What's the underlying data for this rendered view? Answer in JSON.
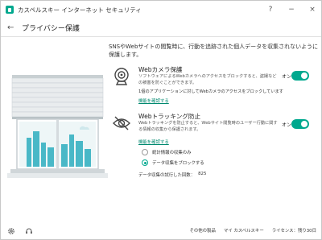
{
  "window": {
    "title": "カスペルスキー インターネット セキュリティ",
    "help": "?",
    "minimize": "−",
    "close": "×"
  },
  "header": {
    "back": "←",
    "title": "プライバシー保護"
  },
  "intro": "SNSやWebサイトの閲覧時に、行動を追跡された個人データを収集されないように保護します。",
  "webcam": {
    "title": "Webカメラ保護",
    "desc": "ソフトウェアによるWebカメラへのアクセスをブロックすると、盗撮などの被害を防ぐことができます。",
    "sub": "1個のアプリケーションに対してWebカメラのアクセスをブロックしています",
    "link": "機能を確認する",
    "toggle_label": "オン",
    "enabled": true
  },
  "tracking": {
    "title": "Webトラッキング防止",
    "desc": "Webトラッキングを防止すると、Webサイト閲覧時のユーザー行動に関する情報の収集から保護されます。",
    "link": "機能を確認する",
    "toggle_label": "オン",
    "enabled": true,
    "options": [
      {
        "label": "統計情報の収集のみ",
        "selected": false
      },
      {
        "label": "データ収集をブロックする",
        "selected": true
      }
    ],
    "attempts_label": "データ収集の試行した回数：",
    "attempts_value": "825"
  },
  "footer": {
    "links": [
      "その他の製品",
      "マイ カスペルスキー",
      "ライセンス：残り30日"
    ]
  },
  "colors": {
    "accent": "#00a88e",
    "link": "#00896f"
  }
}
